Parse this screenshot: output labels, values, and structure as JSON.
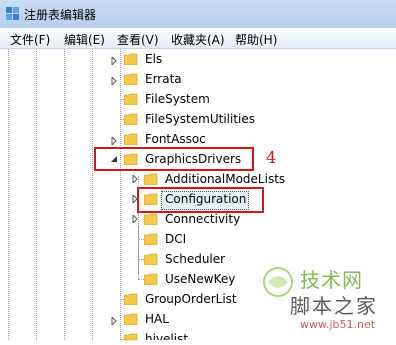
{
  "window": {
    "title": "注册表编辑器",
    "icon": "registry-editor-icon"
  },
  "menu": {
    "items": [
      "文件(F)",
      "编辑(E)",
      "查看(V)",
      "收藏夹(A)",
      "帮助(H)"
    ]
  },
  "tree": {
    "items": [
      {
        "label": "Els",
        "expander": "collapsed"
      },
      {
        "label": "Errata",
        "expander": "collapsed"
      },
      {
        "label": "FileSystem",
        "expander": "none"
      },
      {
        "label": "FileSystemUtilities",
        "expander": "none"
      },
      {
        "label": "FontAssoc",
        "expander": "collapsed"
      },
      {
        "label": "GraphicsDrivers",
        "expander": "expanded"
      },
      {
        "label": "AdditionalModeLists",
        "expander": "collapsed"
      },
      {
        "label": "Configuration",
        "expander": "collapsed",
        "selected": true
      },
      {
        "label": "Connectivity",
        "expander": "collapsed"
      },
      {
        "label": "DCI",
        "expander": "none"
      },
      {
        "label": "Scheduler",
        "expander": "none"
      },
      {
        "label": "UseNewKey",
        "expander": "none"
      },
      {
        "label": "GroupOrderList",
        "expander": "none"
      },
      {
        "label": "HAL",
        "expander": "collapsed"
      },
      {
        "label": "hivelist",
        "expander": "none"
      }
    ]
  },
  "annotation": {
    "step_number": "4",
    "color": "#d01818"
  },
  "watermark": {
    "line1": "技术网",
    "line2": "脚本之家",
    "line3": "www.jb51.net"
  },
  "colors": {
    "folder": "#f2c94c",
    "highlight": "#d01818"
  }
}
